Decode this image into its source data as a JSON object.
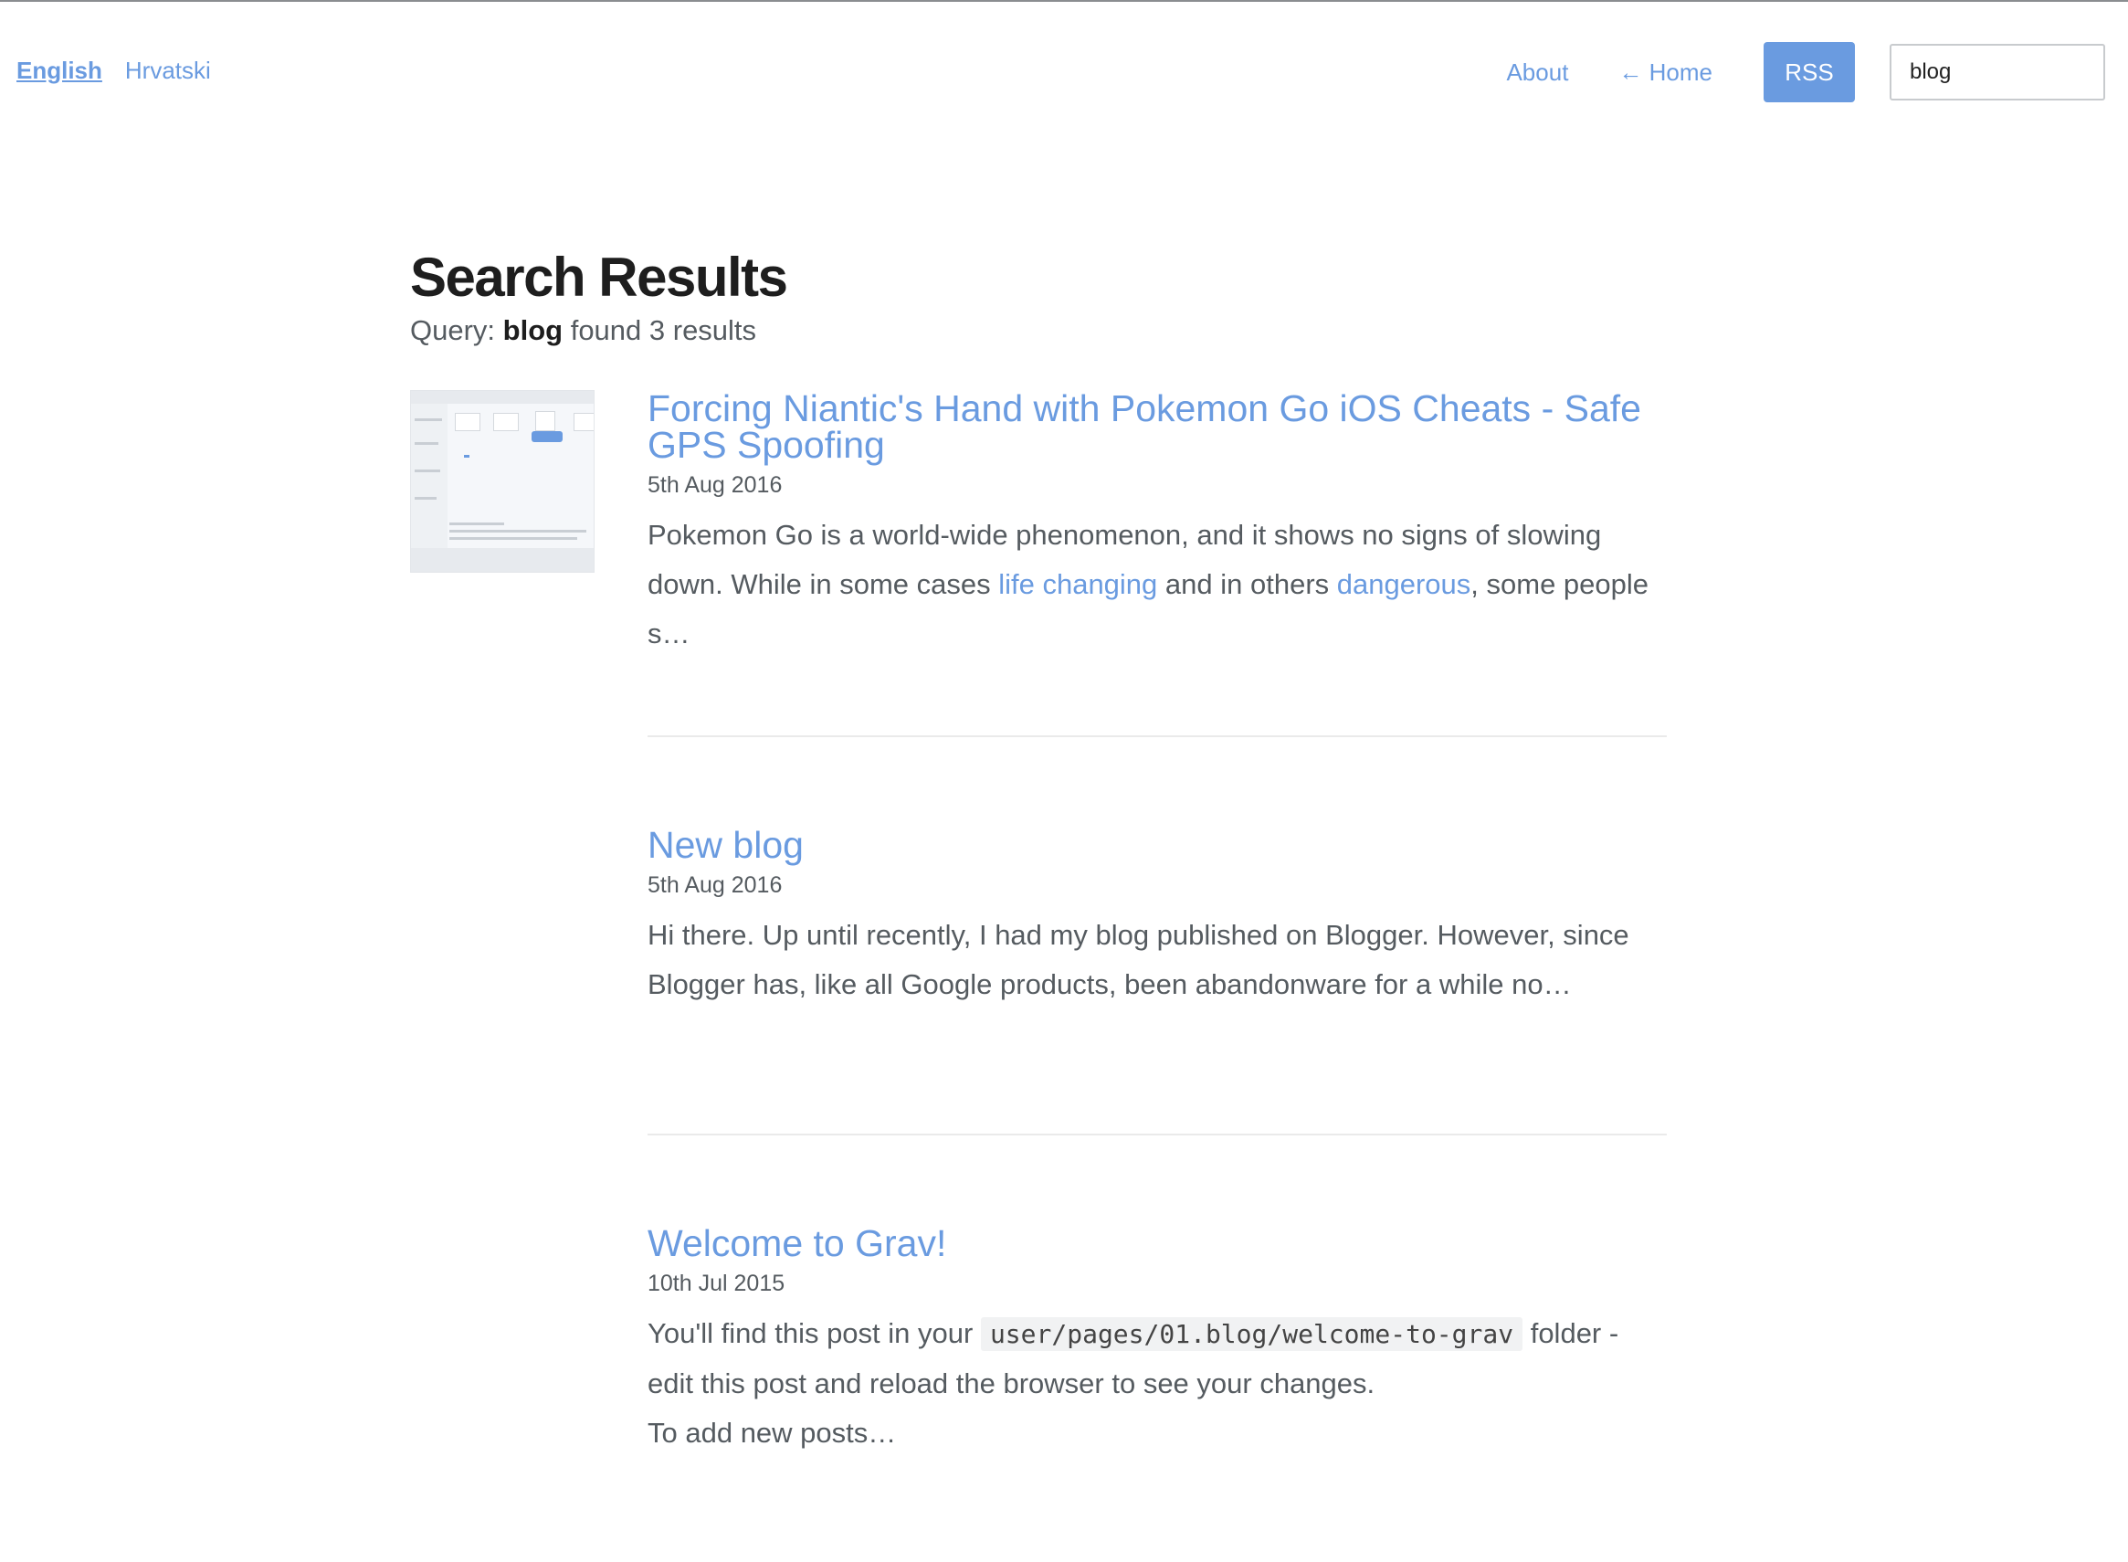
{
  "languages": [
    {
      "label": "English",
      "active": true
    },
    {
      "label": "Hrvatski",
      "active": false
    }
  ],
  "nav": {
    "about": "About",
    "home": "← Home",
    "rss": "RSS"
  },
  "search": {
    "value": "blog"
  },
  "page": {
    "title": "Search Results",
    "query_prefix": "Query:",
    "query_term": "blog",
    "query_suffix": "found 3 results"
  },
  "results": [
    {
      "title": "Forcing Niantic's Hand with Pokemon Go iOS Cheats - Safe GPS Spoofing",
      "date": "5th Aug 2016",
      "excerpt_1": "Pokemon Go is a world-wide phenomenon, and it shows no signs of slowing down. While in some cases ",
      "link_1": "life changing",
      "excerpt_2": " and in others ",
      "link_2": "dangerous",
      "excerpt_3": ", some people s…"
    },
    {
      "title": "New blog",
      "date": "5th Aug 2016",
      "excerpt": "Hi there. Up until recently, I had my blog published on Blogger. However, since Blogger has, like all Google products, been abandonware for a while no…"
    },
    {
      "title": "Welcome to Grav!",
      "date": "10th Jul 2015",
      "excerpt_1": "You'll find this post in your ",
      "code": "user/pages/01.blog/welcome-to-grav",
      "excerpt_2": " folder - edit this post and reload the browser to see your changes.",
      "excerpt_3": "To add new posts…"
    }
  ],
  "colors": {
    "accent": "#6a9be0",
    "heading": "#1e1e1e",
    "body_text": "#555b60",
    "divider": "#eaeaea"
  }
}
